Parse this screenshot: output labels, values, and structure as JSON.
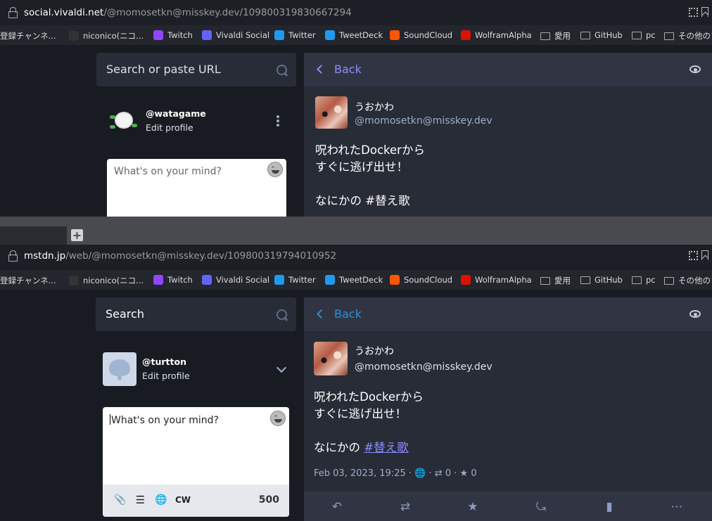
{
  "top": {
    "url_host": "social.vivaldi.net",
    "url_path": "/@momosetkn@misskey.dev/109800319830667294",
    "search_placeholder": "Search or paste URL",
    "account_handle": "@watagame",
    "edit_profile": "Edit profile",
    "compose_placeholder": "What's on your mind?",
    "back_label": "Back",
    "display_name": "うおかわ",
    "username": "@momosetkn@misskey.dev",
    "status_line1": "呪われたDockerから",
    "status_line2": "すぐに逃げ出せ！",
    "status_line3_prefix": "なにかの ",
    "hashtag": "#替え歌",
    "accent": "#8c8dff"
  },
  "bottom": {
    "url_host": "mstdn.jp",
    "url_path": "/web/@momosetkn@misskey.dev/109800319794010952",
    "search_placeholder": "Search",
    "account_handle": "@turtton",
    "edit_profile": "Edit profile",
    "compose_placeholder": "What's on your mind?",
    "cw_label": "CW",
    "char_counter": "500",
    "back_label": "Back",
    "display_name": "うおかわ",
    "username": "@momosetkn@misskey.dev",
    "status_line1": "呪われたDockerから",
    "status_line2": "すぐに逃げ出せ！",
    "status_line3_prefix": "なにかの ",
    "hashtag": "#替え歌",
    "timestamp": "Feb 03, 2023, 19:25",
    "boost_count": "0",
    "fav_count": "0",
    "accent": "#2b90d9"
  },
  "bookmarks": [
    {
      "label": "登録チャンネ...",
      "icon": "channel-icon"
    },
    {
      "label": "niconico(ニコ...",
      "icon": "niconico-icon"
    },
    {
      "label": "Twitch",
      "icon": "twitch-icon"
    },
    {
      "label": "Vivaldi Social",
      "icon": "mastodon-icon"
    },
    {
      "label": "Twitter",
      "icon": "twitter-icon"
    },
    {
      "label": "TweetDeck",
      "icon": "tweetdeck-icon"
    },
    {
      "label": "SoundCloud",
      "icon": "soundcloud-icon"
    },
    {
      "label": "WolframAlpha",
      "icon": "wolfram-icon"
    },
    {
      "label": "愛用",
      "icon": "folder-icon"
    },
    {
      "label": "GitHub",
      "icon": "folder-icon"
    },
    {
      "label": "pc",
      "icon": "folder-icon"
    },
    {
      "label": "その他のブ",
      "icon": "folder-icon"
    }
  ],
  "colors": {
    "twitch": "#9146ff",
    "mastodon": "#6364ff",
    "twitter": "#1d9bf0",
    "soundcloud": "#ff5500",
    "wolfram": "#dd1100",
    "niconico": "#333333"
  },
  "tab_new": "+"
}
